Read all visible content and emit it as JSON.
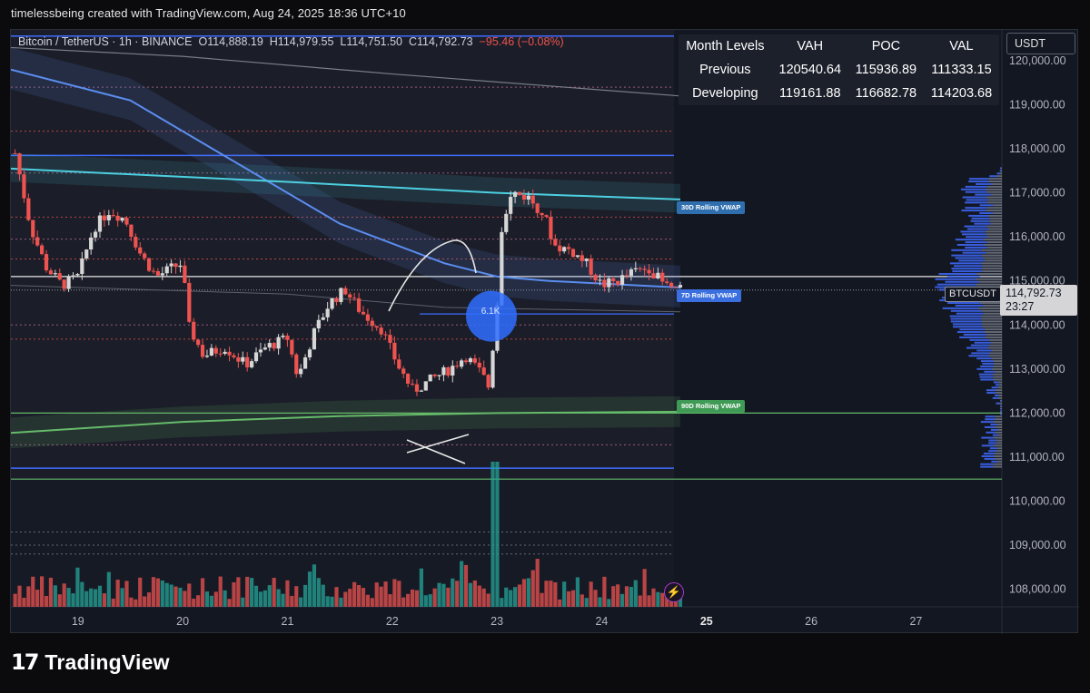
{
  "caption": "timelessbeing created with TradingView.com, Aug 24, 2025 18:36 UTC+10",
  "symbol": {
    "name": "Bitcoin / TetherUS · 1h · BINANCE",
    "open": "O114,888.19",
    "high": "H114,979.55",
    "low": "L114,751.50",
    "close": "C114,792.73",
    "change": "−95.46 (−0.08%)"
  },
  "levels_table": {
    "headers": [
      "Month Levels",
      "VAH",
      "POC",
      "VAL"
    ],
    "rows": [
      {
        "name": "Previous",
        "vah": "120540.64",
        "poc": "115936.89",
        "val": "111333.15"
      },
      {
        "name": "Developing",
        "vah": "119161.88",
        "poc": "116682.78",
        "val": "114203.68"
      }
    ]
  },
  "currency_badge": "USDT",
  "price_badge": {
    "ticker": "BTCUSDT",
    "price": "114,792.73",
    "countdown": "23:27"
  },
  "vwap_labels": {
    "d30": "30D Rolling VWAP",
    "d7": "7D Rolling VWAP",
    "d90": "90D Rolling VWAP"
  },
  "volume_annotation": "6.1K",
  "icons": {
    "bolt": "lightning-icon",
    "logo": "tradingview-logo"
  },
  "brand": "TradingView",
  "colors": {
    "up": "#d6d6d6",
    "down": "#ef5350",
    "vol_up": "#26a69a",
    "vol_down": "#ef5350",
    "vwap30": "#4dd0e1",
    "vwap7": "#5b8def",
    "vwap90": "#66bb6a",
    "level_line": "#3f6bff",
    "poc_dotted": "#ef5350"
  },
  "chart_data": {
    "type": "candlestick",
    "timeframe": "1h",
    "x_ticks": [
      "19",
      "20",
      "21",
      "22",
      "23",
      "24",
      "25",
      "26",
      "27"
    ],
    "y_ticks": [
      "120,000.00",
      "119,000.00",
      "118,000.00",
      "117,000.00",
      "116,000.00",
      "115,000.00",
      "114,000.00",
      "113,000.00",
      "112,000.00",
      "111,000.00",
      "110,000.00",
      "109,000.00",
      "108,000.00"
    ],
    "y_range": [
      107600,
      120700
    ],
    "x_range_days": [
      18.36,
      27.82
    ],
    "last_price": 114792.73,
    "key_levels": [
      117850,
      110750,
      110500,
      112000
    ],
    "vwap_30d": [
      [
        18.36,
        117550
      ],
      [
        21.0,
        117250
      ],
      [
        23.0,
        117000
      ],
      [
        24.75,
        116850
      ]
    ],
    "vwap_7d": [
      [
        18.36,
        119800
      ],
      [
        19.5,
        119100
      ],
      [
        20.5,
        117700
      ],
      [
        21.5,
        116300
      ],
      [
        22.5,
        115400
      ],
      [
        23.0,
        115100
      ],
      [
        23.5,
        115000
      ],
      [
        24.75,
        114850
      ]
    ],
    "vwap_90d": [
      [
        18.36,
        111550
      ],
      [
        20.0,
        111800
      ],
      [
        21.5,
        111930
      ],
      [
        23.0,
        112000
      ],
      [
        24.75,
        112030
      ]
    ],
    "candles_close_path": [
      [
        18.4,
        117900
      ],
      [
        18.55,
        116200
      ],
      [
        18.7,
        115300
      ],
      [
        18.85,
        114900
      ],
      [
        19.0,
        115100
      ],
      [
        19.15,
        116200
      ],
      [
        19.3,
        116600
      ],
      [
        19.45,
        116400
      ],
      [
        19.6,
        115600
      ],
      [
        19.75,
        115100
      ],
      [
        19.9,
        115300
      ],
      [
        20.0,
        115400
      ],
      [
        20.05,
        114000
      ],
      [
        20.2,
        113300
      ],
      [
        20.4,
        113500
      ],
      [
        20.6,
        113100
      ],
      [
        20.8,
        113500
      ],
      [
        21.0,
        113700
      ],
      [
        21.1,
        112800
      ],
      [
        21.25,
        113800
      ],
      [
        21.4,
        114500
      ],
      [
        21.55,
        114800
      ],
      [
        21.7,
        114300
      ],
      [
        21.9,
        113900
      ],
      [
        22.05,
        113100
      ],
      [
        22.2,
        112500
      ],
      [
        22.4,
        112800
      ],
      [
        22.55,
        113000
      ],
      [
        22.7,
        113300
      ],
      [
        22.85,
        112900
      ],
      [
        22.92,
        112600
      ],
      [
        23.0,
        114400
      ],
      [
        23.05,
        116400
      ],
      [
        23.15,
        117000
      ],
      [
        23.3,
        116900
      ],
      [
        23.45,
        116500
      ],
      [
        23.55,
        115800
      ],
      [
        23.7,
        115700
      ],
      [
        23.85,
        115400
      ],
      [
        24.0,
        114900
      ],
      [
        24.15,
        115000
      ],
      [
        24.3,
        115200
      ],
      [
        24.45,
        115300
      ],
      [
        24.6,
        114900
      ],
      [
        24.75,
        114790
      ]
    ]
  }
}
